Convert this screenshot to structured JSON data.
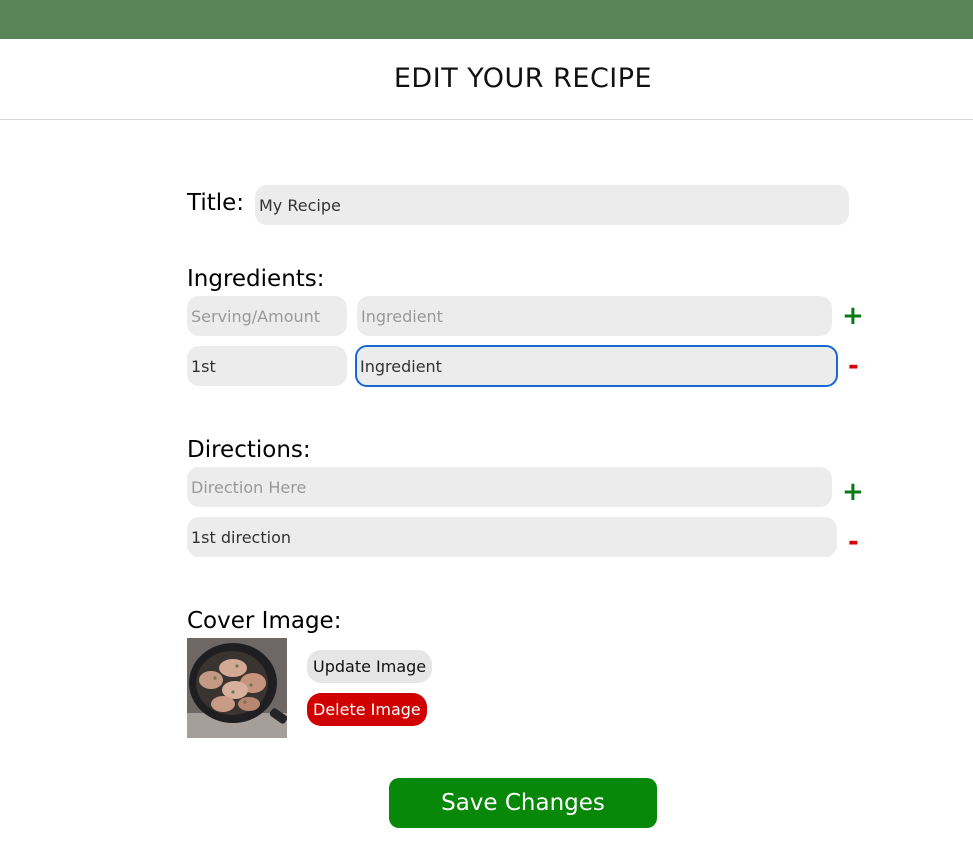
{
  "header": {
    "title": "EDIT YOUR RECIPE"
  },
  "title_section": {
    "label": "Title:",
    "value": "My Recipe"
  },
  "ingredients": {
    "label": "Ingredients:",
    "new_row": {
      "amount_placeholder": "Serving/Amount",
      "ingredient_placeholder": "Ingredient",
      "add_symbol": "+"
    },
    "rows": [
      {
        "amount": "1st",
        "ingredient": "Ingredient",
        "remove_symbol": "-"
      }
    ]
  },
  "directions": {
    "label": "Directions:",
    "new_row": {
      "placeholder": "Direction Here",
      "add_symbol": "+"
    },
    "rows": [
      {
        "text": "1st direction",
        "remove_symbol": "-"
      }
    ]
  },
  "cover": {
    "label": "Cover Image:",
    "update_label": "Update Image",
    "delete_label": "Delete Image"
  },
  "save_label": "Save Changes",
  "colors": {
    "topbar": "#588457",
    "add": "#0a7a16",
    "remove": "#d10000",
    "save": "#088808",
    "focus": "#1769d1"
  }
}
